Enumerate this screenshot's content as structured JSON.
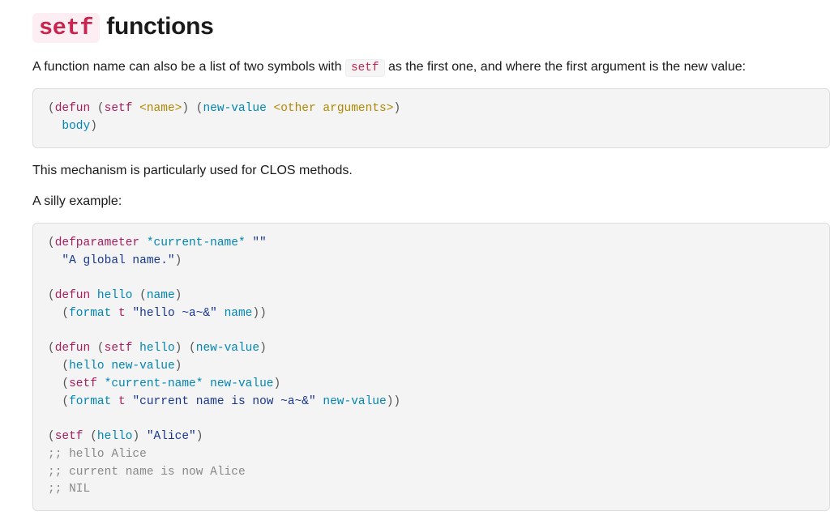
{
  "heading": {
    "setf": "setf",
    "rest": " functions"
  },
  "p1": {
    "before": "A function name can also be a list of two symbols with ",
    "code": "setf",
    "after": " as the first one, and where the first argument is the new value:"
  },
  "code1": {
    "tokens": [
      {
        "c": "p",
        "t": "("
      },
      {
        "c": "kw",
        "t": "defun"
      },
      {
        "c": "p",
        "t": " ("
      },
      {
        "c": "kw",
        "t": "setf"
      },
      {
        "c": "p",
        "t": " "
      },
      {
        "c": "var",
        "t": "<name>"
      },
      {
        "c": "p",
        "t": ") ("
      },
      {
        "c": "nm",
        "t": "new-value"
      },
      {
        "c": "p",
        "t": " "
      },
      {
        "c": "var",
        "t": "<other arguments>"
      },
      {
        "c": "p",
        "t": ")"
      },
      {
        "c": "",
        "t": "\n  "
      },
      {
        "c": "nm",
        "t": "body"
      },
      {
        "c": "p",
        "t": ")"
      }
    ]
  },
  "p2": "This mechanism is particularly used for CLOS methods.",
  "p3": "A silly example:",
  "code2": {
    "tokens": [
      {
        "c": "p",
        "t": "("
      },
      {
        "c": "kw",
        "t": "defparameter"
      },
      {
        "c": "p",
        "t": " "
      },
      {
        "c": "nm",
        "t": "*current-name*"
      },
      {
        "c": "p",
        "t": " "
      },
      {
        "c": "str",
        "t": "\"\""
      },
      {
        "c": "",
        "t": "\n  "
      },
      {
        "c": "str",
        "t": "\"A global name.\""
      },
      {
        "c": "p",
        "t": ")"
      },
      {
        "c": "",
        "t": "\n\n"
      },
      {
        "c": "p",
        "t": "("
      },
      {
        "c": "kw",
        "t": "defun"
      },
      {
        "c": "p",
        "t": " "
      },
      {
        "c": "nm",
        "t": "hello"
      },
      {
        "c": "p",
        "t": " ("
      },
      {
        "c": "nm",
        "t": "name"
      },
      {
        "c": "p",
        "t": ")"
      },
      {
        "c": "",
        "t": "\n  "
      },
      {
        "c": "p",
        "t": "("
      },
      {
        "c": "nm",
        "t": "format"
      },
      {
        "c": "p",
        "t": " "
      },
      {
        "c": "lit",
        "t": "t"
      },
      {
        "c": "p",
        "t": " "
      },
      {
        "c": "str",
        "t": "\"hello ~a~&\""
      },
      {
        "c": "p",
        "t": " "
      },
      {
        "c": "nm",
        "t": "name"
      },
      {
        "c": "p",
        "t": "))"
      },
      {
        "c": "",
        "t": "\n\n"
      },
      {
        "c": "p",
        "t": "("
      },
      {
        "c": "kw",
        "t": "defun"
      },
      {
        "c": "p",
        "t": " ("
      },
      {
        "c": "kw",
        "t": "setf"
      },
      {
        "c": "p",
        "t": " "
      },
      {
        "c": "nm",
        "t": "hello"
      },
      {
        "c": "p",
        "t": ") ("
      },
      {
        "c": "nm",
        "t": "new-value"
      },
      {
        "c": "p",
        "t": ")"
      },
      {
        "c": "",
        "t": "\n  "
      },
      {
        "c": "p",
        "t": "("
      },
      {
        "c": "nm",
        "t": "hello"
      },
      {
        "c": "p",
        "t": " "
      },
      {
        "c": "nm",
        "t": "new-value"
      },
      {
        "c": "p",
        "t": ")"
      },
      {
        "c": "",
        "t": "\n  "
      },
      {
        "c": "p",
        "t": "("
      },
      {
        "c": "kw",
        "t": "setf"
      },
      {
        "c": "p",
        "t": " "
      },
      {
        "c": "nm",
        "t": "*current-name*"
      },
      {
        "c": "p",
        "t": " "
      },
      {
        "c": "nm",
        "t": "new-value"
      },
      {
        "c": "p",
        "t": ")"
      },
      {
        "c": "",
        "t": "\n  "
      },
      {
        "c": "p",
        "t": "("
      },
      {
        "c": "nm",
        "t": "format"
      },
      {
        "c": "p",
        "t": " "
      },
      {
        "c": "lit",
        "t": "t"
      },
      {
        "c": "p",
        "t": " "
      },
      {
        "c": "str",
        "t": "\"current name is now ~a~&\""
      },
      {
        "c": "p",
        "t": " "
      },
      {
        "c": "nm",
        "t": "new-value"
      },
      {
        "c": "p",
        "t": "))"
      },
      {
        "c": "",
        "t": "\n\n"
      },
      {
        "c": "p",
        "t": "("
      },
      {
        "c": "kw",
        "t": "setf"
      },
      {
        "c": "p",
        "t": " ("
      },
      {
        "c": "nm",
        "t": "hello"
      },
      {
        "c": "p",
        "t": ") "
      },
      {
        "c": "str",
        "t": "\"Alice\""
      },
      {
        "c": "p",
        "t": ")"
      },
      {
        "c": "",
        "t": "\n"
      },
      {
        "c": "com",
        "t": ";; hello Alice"
      },
      {
        "c": "",
        "t": "\n"
      },
      {
        "c": "com",
        "t": ";; current name is now Alice"
      },
      {
        "c": "",
        "t": "\n"
      },
      {
        "c": "com",
        "t": ";; NIL"
      }
    ]
  }
}
